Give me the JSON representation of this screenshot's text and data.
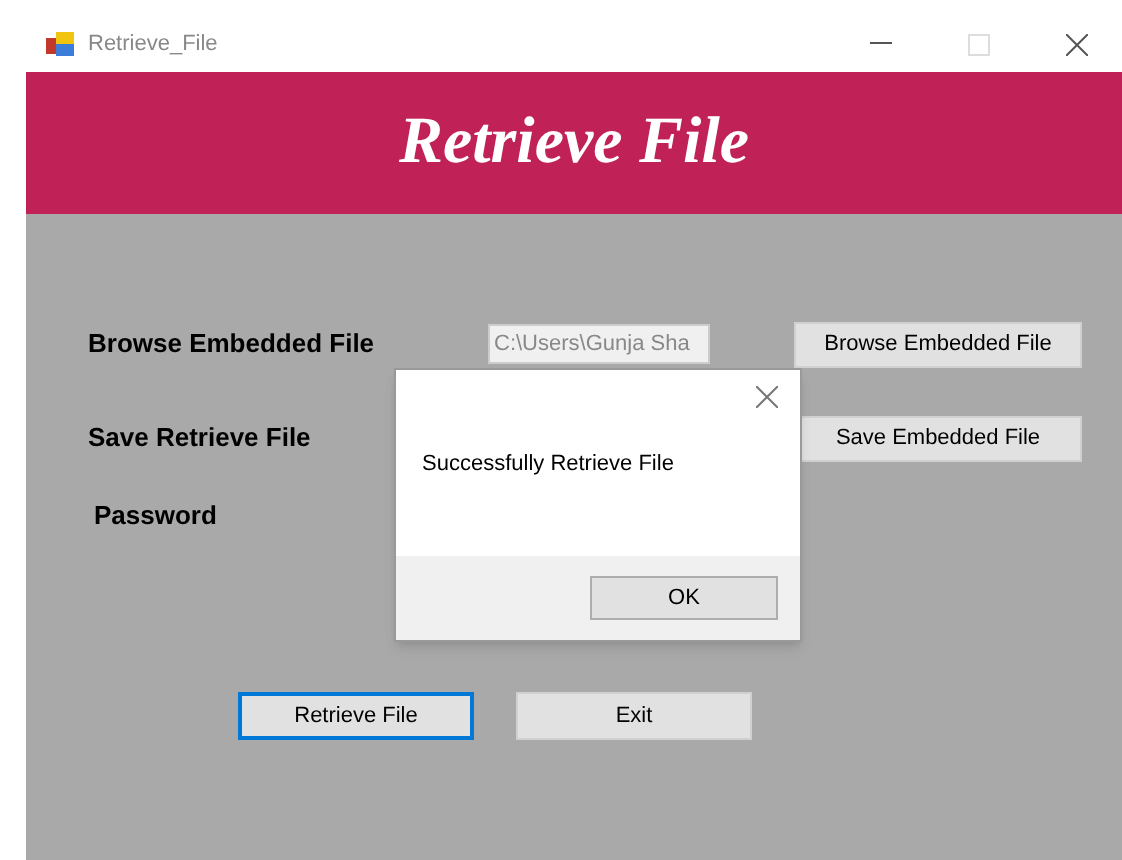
{
  "window": {
    "title": "Retrieve_File"
  },
  "header": {
    "title": "Retrieve File"
  },
  "rows": [
    {
      "label": "Browse Embedded File",
      "value": "C:\\Users\\Gunja Sha",
      "button": "Browse Embedded File"
    },
    {
      "label": "Save Retrieve File",
      "button": "Save Embedded File"
    },
    {
      "label": "Password"
    }
  ],
  "buttons": [
    {
      "label": "Retrieve File",
      "focused": true
    },
    {
      "label": "Exit",
      "focused": false
    }
  ],
  "dialog": {
    "message": "Successfully Retrieve File",
    "button": "OK"
  }
}
